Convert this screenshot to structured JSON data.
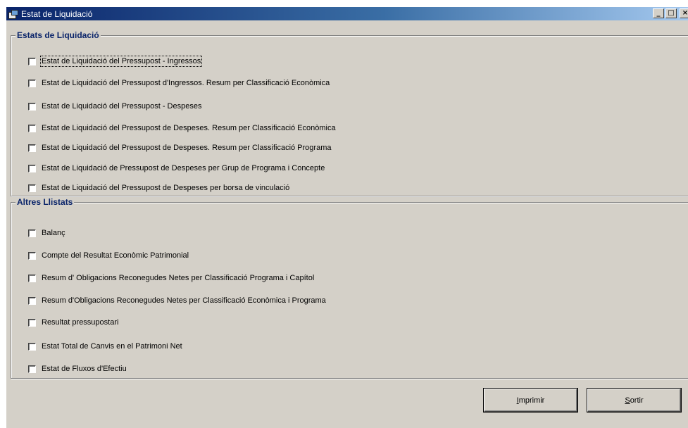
{
  "window": {
    "title": "Estat de Liquidació",
    "minimize_glyph": "_",
    "maximize_glyph": "□",
    "close_glyph": "×"
  },
  "groups": {
    "liquidacio": {
      "title": "Estats de Liquidació",
      "items": [
        "Estat de Liquidació del Pressupost - Ingressos",
        "Estat de Liquidació del Pressupost d'Ingressos. Resum per Classificació Econòmica",
        "Estat de Liquidació del Pressupost - Despeses",
        "Estat de Liquidació del Pressupost de Despeses. Resum per Classificació Econòmica",
        "Estat de Liquidació del Pressupost de Despeses. Resum per Classificació Programa",
        "Estat de Liquidació de Pressupost de Despeses per Grup de Programa i Concepte",
        "Estat de Liquidació del Pressupost de Despeses per borsa de vinculació"
      ]
    },
    "altres": {
      "title": "Altres Llistats",
      "items": [
        "Balanç",
        "Compte del Resultat Econòmic Patrimonial",
        "Resum d' Obligacions Reconegudes Netes per Classificació Programa i Capítol",
        "Resum d'Obligacions Reconegudes Netes per Classificació Econòmica i Programa",
        "Resultat pressupostari",
        "Estat Total de Canvis en el Patrimoni Net",
        "Estat de Fluxos d'Efectiu"
      ]
    }
  },
  "buttons": {
    "print": {
      "accel": "I",
      "rest": "mprimir"
    },
    "exit": {
      "accel": "S",
      "rest": "ortir"
    }
  }
}
